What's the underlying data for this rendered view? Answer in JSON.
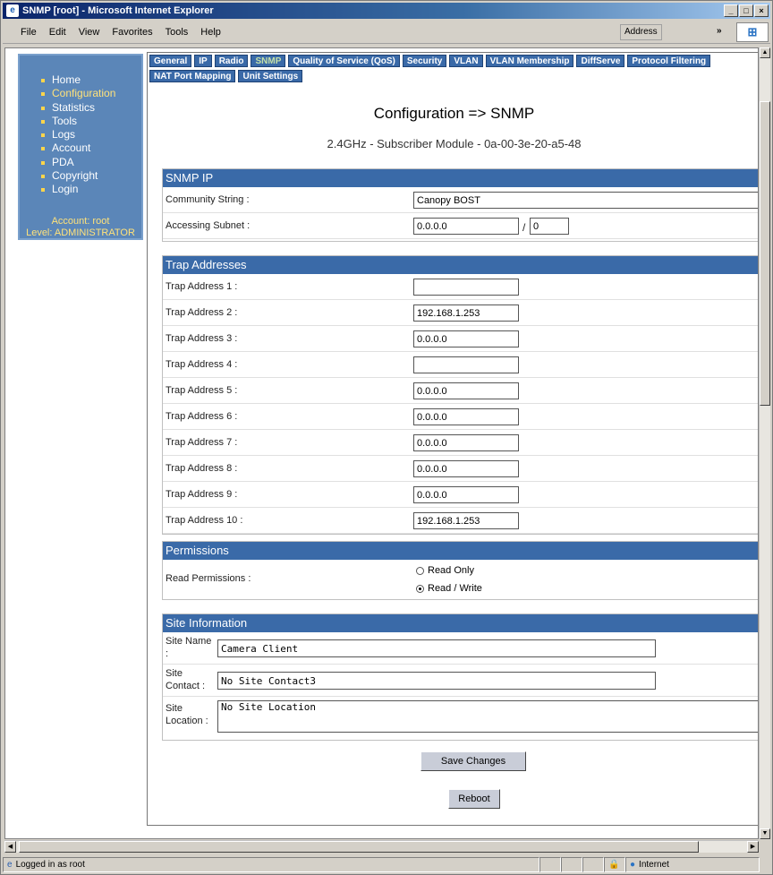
{
  "window": {
    "title": "SNMP [root] - Microsoft Internet Explorer"
  },
  "menu": [
    "File",
    "Edit",
    "View",
    "Favorites",
    "Tools",
    "Help"
  ],
  "address": {
    "label": "Address",
    "go": "»"
  },
  "sidebar": {
    "items": [
      {
        "label": "Home",
        "active": false
      },
      {
        "label": "Configuration",
        "active": true
      },
      {
        "label": "Statistics",
        "active": false
      },
      {
        "label": "Tools",
        "active": false
      },
      {
        "label": "Logs",
        "active": false
      },
      {
        "label": "Account",
        "active": false
      },
      {
        "label": "PDA",
        "active": false
      },
      {
        "label": "Copyright",
        "active": false
      },
      {
        "label": "Login",
        "active": false
      }
    ],
    "account_line": "Account: root",
    "level_line": "Level: ADMINISTRATOR"
  },
  "tabs": [
    "General",
    "IP",
    "Radio",
    "SNMP",
    "Quality of Service (QoS)",
    "Security",
    "VLAN",
    "VLAN Membership",
    "DiffServe",
    "Protocol Filtering",
    "NAT Port Mapping",
    "Unit Settings"
  ],
  "active_tab": "SNMP",
  "page": {
    "title": "Configuration => SNMP",
    "subtitle": "2.4GHz - Subscriber Module - 0a-00-3e-20-a5-48"
  },
  "snmp_ip": {
    "header": "SNMP IP",
    "community_label": "Community String :",
    "community_value": "Canopy BOST",
    "subnet_label": "Accessing Subnet :",
    "subnet_value": "0.0.0.0",
    "subnet_mask": "0"
  },
  "trap": {
    "header": "Trap Addresses",
    "items": [
      {
        "label": "Trap Address 1 :",
        "value": ""
      },
      {
        "label": "Trap Address 2 :",
        "value": "192.168.1.253"
      },
      {
        "label": "Trap Address 3 :",
        "value": "0.0.0.0"
      },
      {
        "label": "Trap Address 4 :",
        "value": ""
      },
      {
        "label": "Trap Address 5 :",
        "value": "0.0.0.0"
      },
      {
        "label": "Trap Address 6 :",
        "value": "0.0.0.0"
      },
      {
        "label": "Trap Address 7 :",
        "value": "0.0.0.0"
      },
      {
        "label": "Trap Address 8 :",
        "value": "0.0.0.0"
      },
      {
        "label": "Trap Address 9 :",
        "value": "0.0.0.0"
      },
      {
        "label": "Trap Address 10 :",
        "value": "192.168.1.253"
      }
    ]
  },
  "permissions": {
    "header": "Permissions",
    "label": "Read Permissions :",
    "option_ro": "Read Only",
    "option_rw": "Read / Write",
    "selected": "Read / Write"
  },
  "site": {
    "header": "Site Information",
    "name_label": "Site Name :",
    "name_value": "Camera Client",
    "contact_label": "Site Contact :",
    "contact_value": "No Site Contact3",
    "location_label": "Site Location :",
    "location_value": "No Site Location"
  },
  "buttons": {
    "save": "Save Changes",
    "reboot": "Reboot"
  },
  "status": {
    "left": "Logged in as root",
    "zone": "Internet"
  }
}
